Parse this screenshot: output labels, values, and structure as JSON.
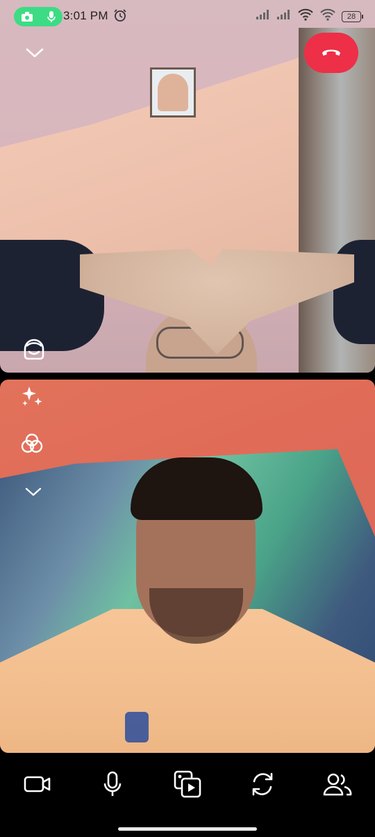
{
  "status_bar": {
    "time": "3:01 PM",
    "battery": "28",
    "icons": [
      "camera-icon",
      "mic-icon",
      "alarm-icon",
      "signal-icon",
      "signal-icon",
      "wifi-icon",
      "wifi-icon",
      "battery-icon"
    ]
  },
  "colors": {
    "end_call": "#ed2f47",
    "recording_pill": "#3ddc84"
  },
  "remote_video": {
    "controls": [
      "chevron-down-icon",
      "end-call-icon",
      "face-effects-icon"
    ]
  },
  "self_video": {
    "controls": [
      "sparkle-icon",
      "filters-icon",
      "chevron-down-icon"
    ]
  },
  "toolbar": {
    "items": [
      "video-camera-icon",
      "microphone-icon",
      "share-media-icon",
      "flip-camera-icon",
      "participants-icon"
    ]
  }
}
